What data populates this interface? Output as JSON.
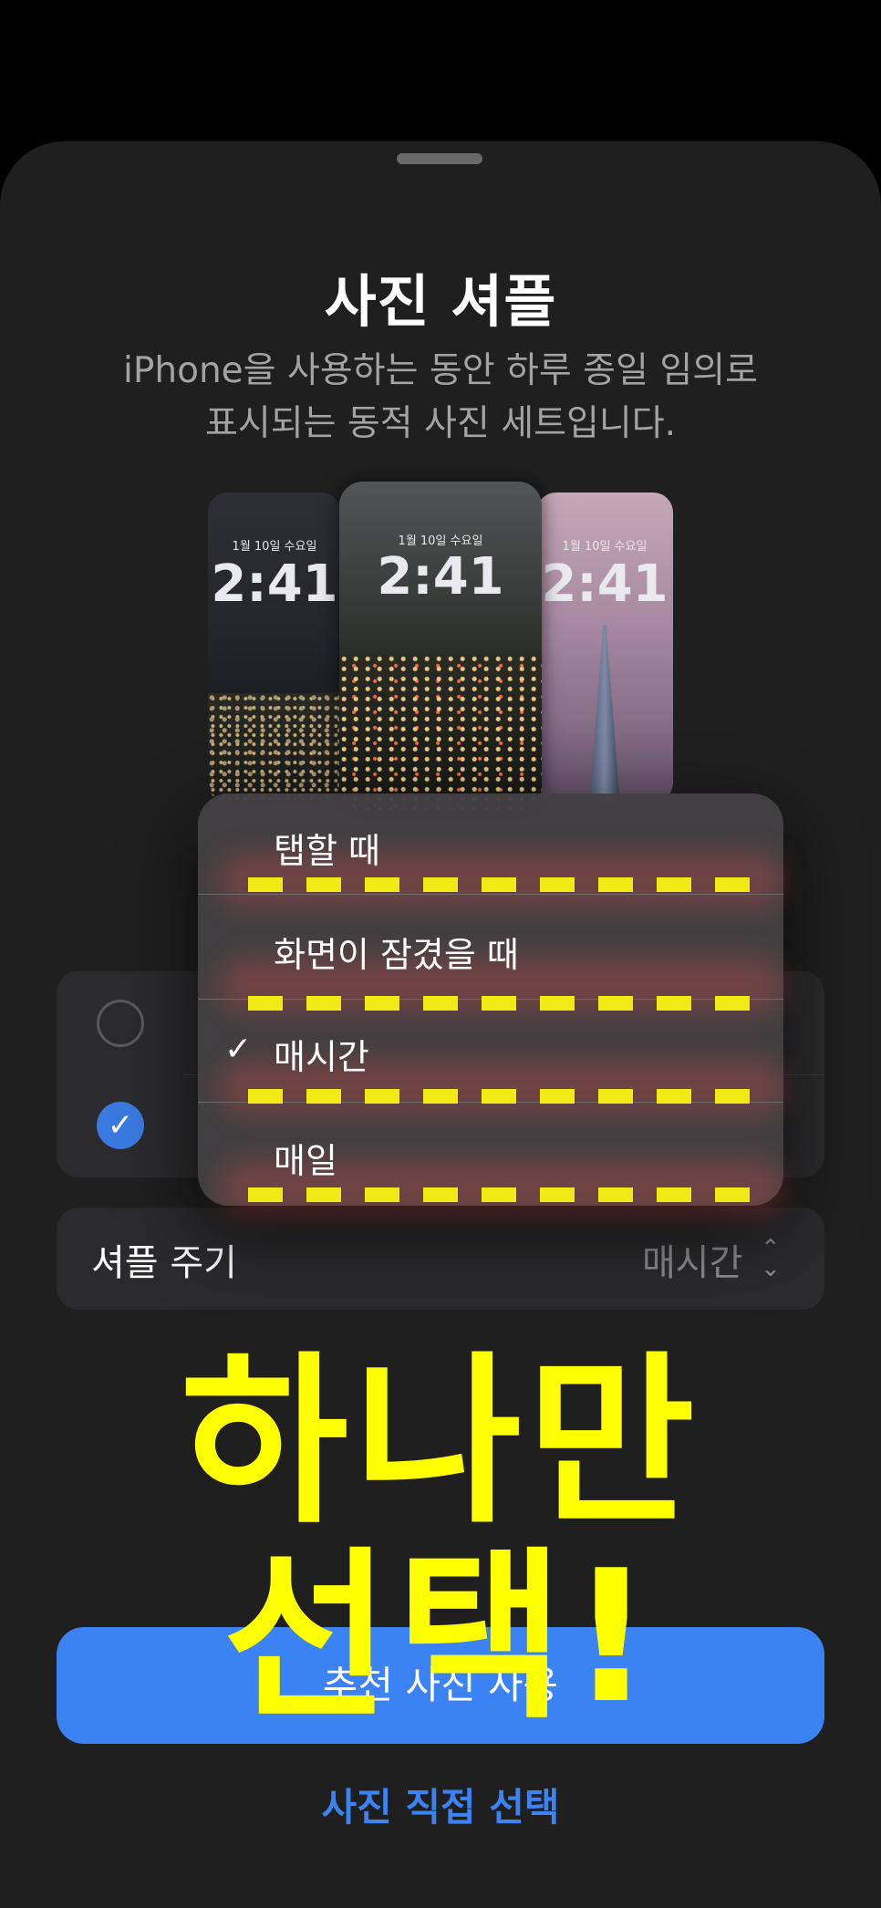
{
  "sheet": {
    "title": "사진 셔플",
    "subtitle_line1": "iPhone을 사용하는 동안 하루 종일 임의로",
    "subtitle_line2": "표시되는 동적 사진 세트입니다."
  },
  "previews": [
    {
      "date": "1월 10일 수요일",
      "time": "2:41"
    },
    {
      "date": "1월 10일 수요일",
      "time": "2:41"
    },
    {
      "date": "1월 10일 수요일",
      "time": "2:41"
    }
  ],
  "menu": {
    "items": [
      {
        "label": "탭할 때",
        "checked": false
      },
      {
        "label": "화면이 잠겼을 때",
        "checked": false
      },
      {
        "label": "매시간",
        "checked": true
      },
      {
        "label": "매일",
        "checked": false
      }
    ],
    "check_glyph": "✓"
  },
  "options": [
    {
      "selected": false
    },
    {
      "selected": true
    }
  ],
  "shuffle": {
    "label": "셔플 주기",
    "value": "매시간",
    "icon": "chevron-up-down-icon"
  },
  "buttons": {
    "primary": "추천 사진 사용",
    "secondary": "사진 직접 선택"
  },
  "overlay": {
    "line1": "하나만",
    "line2": "선택!"
  },
  "colors": {
    "accent": "#3b82f2",
    "highlight": "#ffff00",
    "background": "#1f1f1f"
  }
}
